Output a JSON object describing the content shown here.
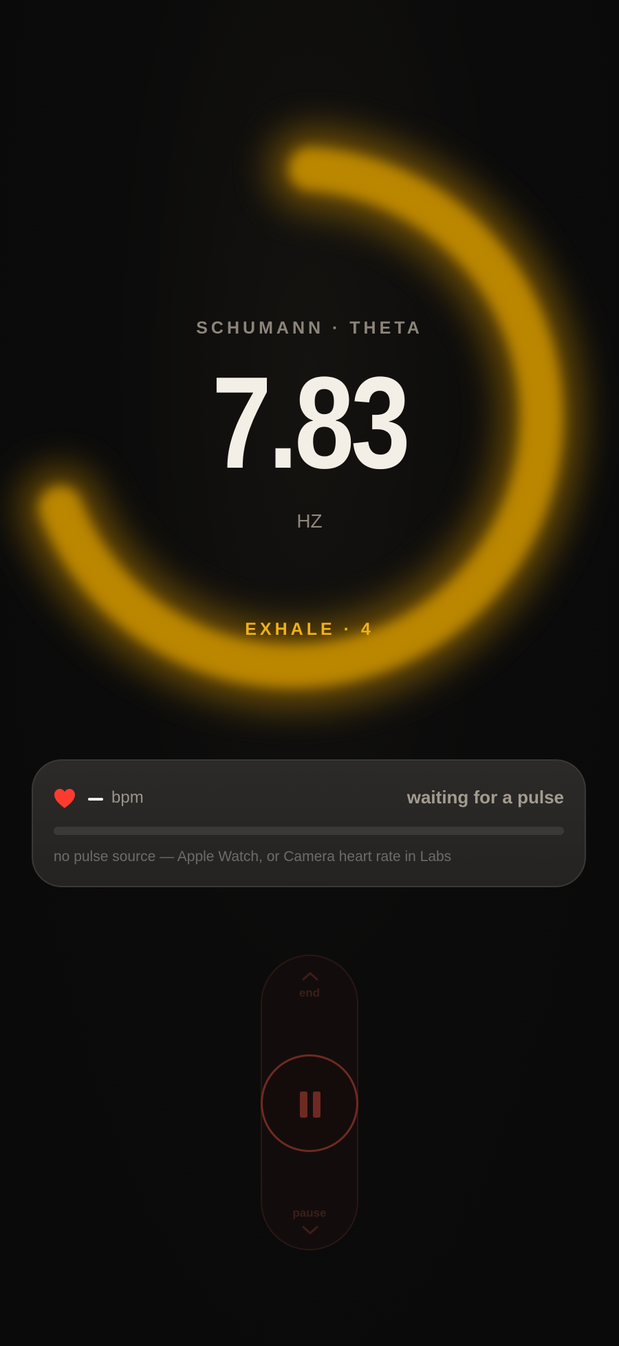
{
  "session": {
    "mode_label": "SCHUMANN · THETA",
    "frequency_value": "7.83",
    "frequency_unit": "HZ",
    "breath_phase": "EXHALE · 4",
    "accent_color": "#f0b118"
  },
  "pulse_card": {
    "bpm_value": "—",
    "bpm_unit": "bpm",
    "status": "waiting for a pulse",
    "progress": 0,
    "hint": "no pulse source — Apple Watch, or Camera heart rate in Labs",
    "heart_color": "#ff3b30"
  },
  "controls": {
    "end_label": "end",
    "pause_label": "pause",
    "icons": {
      "up": "chevron-up-icon",
      "down": "chevron-down-icon",
      "pause": "pause-icon",
      "heart": "heart-icon"
    },
    "control_color": "#6e2a22"
  }
}
